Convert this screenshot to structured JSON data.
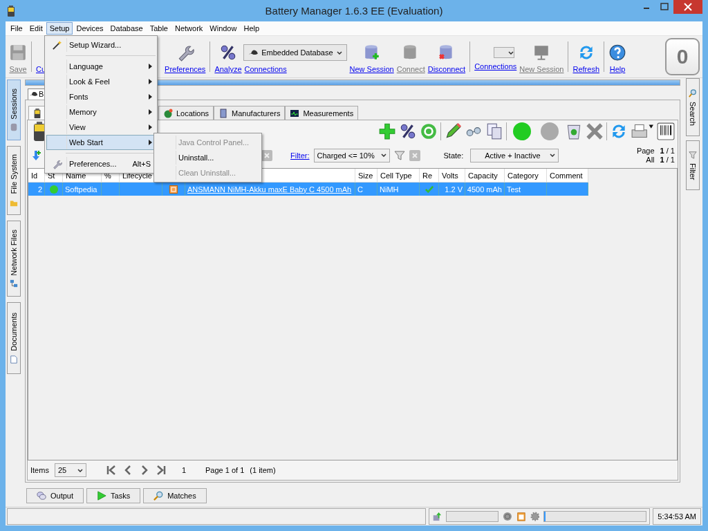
{
  "window": {
    "title": "Battery Manager 1.6.3 EE (Evaluation)"
  },
  "menu_bar": [
    {
      "label": "File",
      "selected": false
    },
    {
      "label": "Edit",
      "selected": false
    },
    {
      "label": "Setup",
      "selected": true
    },
    {
      "label": "Devices",
      "selected": false
    },
    {
      "label": "Database",
      "selected": false
    },
    {
      "label": "Table",
      "selected": false
    },
    {
      "label": "Network",
      "selected": false
    },
    {
      "label": "Window",
      "selected": false
    },
    {
      "label": "Help",
      "selected": false
    }
  ],
  "toolbar_left": [
    {
      "kind": "button",
      "label": "Save",
      "disabled": true
    },
    {
      "kind": "button",
      "label": "Cu",
      "disabled": false
    }
  ],
  "toolbar_right": [
    {
      "kind": "button",
      "label": "Preferences",
      "disabled": false
    },
    {
      "kind": "button",
      "label": "Analyze",
      "disabled": false
    },
    {
      "kind": "combo",
      "label": "Connections",
      "value": "Embedded Database",
      "disabled": false
    },
    {
      "kind": "button",
      "label": "New Session",
      "disabled": false
    },
    {
      "kind": "button",
      "label": "Connect",
      "disabled": true
    },
    {
      "kind": "button",
      "label": "Disconnect",
      "disabled": false
    },
    {
      "kind": "combo",
      "label": "Connections",
      "disabled": false
    },
    {
      "kind": "button",
      "label": "New Session",
      "disabled": true
    },
    {
      "kind": "button",
      "label": "Refresh",
      "disabled": false
    },
    {
      "kind": "button",
      "label": "Help",
      "disabled": false
    }
  ],
  "counter": "0",
  "progress": {
    "level": 1
  },
  "side_tabs_left": [
    {
      "label": "Sessions",
      "selected": true
    },
    {
      "label": "File System",
      "selected": false
    },
    {
      "label": "Network Files",
      "selected": false
    },
    {
      "label": "Documents",
      "selected": false
    }
  ],
  "side_tabs_right": [
    {
      "label": "Search"
    },
    {
      "label": "Filter"
    }
  ],
  "session_tabs": [
    {
      "label": "B",
      "selected": true
    }
  ],
  "view_tabs": [
    {
      "kind": "icon",
      "selected": true
    },
    {
      "kind": "text",
      "label": "Locations",
      "selected": false
    },
    {
      "kind": "text",
      "label": "Manufacturers",
      "selected": false
    },
    {
      "kind": "text",
      "label": "Measurements",
      "selected": false
    }
  ],
  "filter": {
    "link": "Filter:",
    "value": "Charged <= 10%"
  },
  "state": {
    "label": "State:",
    "value": "Active + Inactive"
  },
  "paging": {
    "page_label": "Page",
    "page": "**1** / 1",
    "all_label": "All",
    "all": "**1** / 1"
  },
  "table": {
    "columns": [
      {
        "kind": "text",
        "label": "Id"
      },
      {
        "kind": "text",
        "label": "St"
      },
      {
        "kind": "text",
        "label": "Name"
      },
      {
        "kind": "text",
        "label": "%"
      },
      {
        "kind": "text",
        "label": "Lifecycle"
      },
      {
        "kind": "blank"
      },
      {
        "kind": "blank"
      },
      {
        "kind": "text",
        "label": "Size"
      },
      {
        "kind": "text",
        "label": "Cell Type"
      },
      {
        "kind": "text",
        "label": "Re"
      },
      {
        "kind": "text",
        "label": "Volts"
      },
      {
        "kind": "text",
        "label": "Capacity"
      },
      {
        "kind": "text",
        "label": "Category"
      },
      {
        "kind": "text",
        "label": "Comment"
      }
    ],
    "rows": [
      {
        "selected": true,
        "id": "2",
        "color": "#33cc33",
        "name": "Softpedia",
        "battery": "ANSMANN NiMH-Akku maxE Baby C 4500 mAh",
        "size": "C",
        "cell_type": "NiMH",
        "rechargeable": true,
        "volts": "1.2 V",
        "capacity": "4500 mAh",
        "category": "Test"
      }
    ]
  },
  "footer": {
    "items_label": "Items",
    "items_per_page": "25",
    "page_input": "1",
    "page_info": "Page 1 of 1",
    "item_count": "(1 item)"
  },
  "bottom_tabs": [
    {
      "label": "Output"
    },
    {
      "label": "Tasks"
    },
    {
      "label": "Matches"
    }
  ],
  "status_bar": {
    "task_progress": {
      "level": 0
    },
    "memory": {
      "level": 0.01
    },
    "clock": "5:34:53 AM"
  },
  "setup_menu": [
    {
      "kind": "item",
      "label": "Setup Wizard...",
      "submenu": false,
      "selected": false
    },
    {
      "kind": "separator"
    },
    {
      "kind": "item",
      "label": "Language",
      "submenu": true,
      "selected": false
    },
    {
      "kind": "item",
      "label": "Look & Feel",
      "submenu": true,
      "selected": false
    },
    {
      "kind": "item",
      "label": "Fonts",
      "submenu": true,
      "selected": false
    },
    {
      "kind": "item",
      "label": "Memory",
      "submenu": true,
      "selected": false
    },
    {
      "kind": "item",
      "label": "View",
      "submenu": true,
      "selected": false
    },
    {
      "kind": "item",
      "label": "Web Start",
      "submenu": true,
      "selected": true
    },
    {
      "kind": "separator"
    },
    {
      "kind": "item",
      "label": "Preferences...",
      "shortcut": "Alt+S",
      "submenu": false,
      "selected": false
    }
  ],
  "web_start_menu": [
    {
      "label": "Java Control Panel...",
      "disabled": true
    },
    {
      "label": "Uninstall...",
      "disabled": false
    },
    {
      "label": "Clean Uninstall...",
      "disabled": true
    }
  ]
}
